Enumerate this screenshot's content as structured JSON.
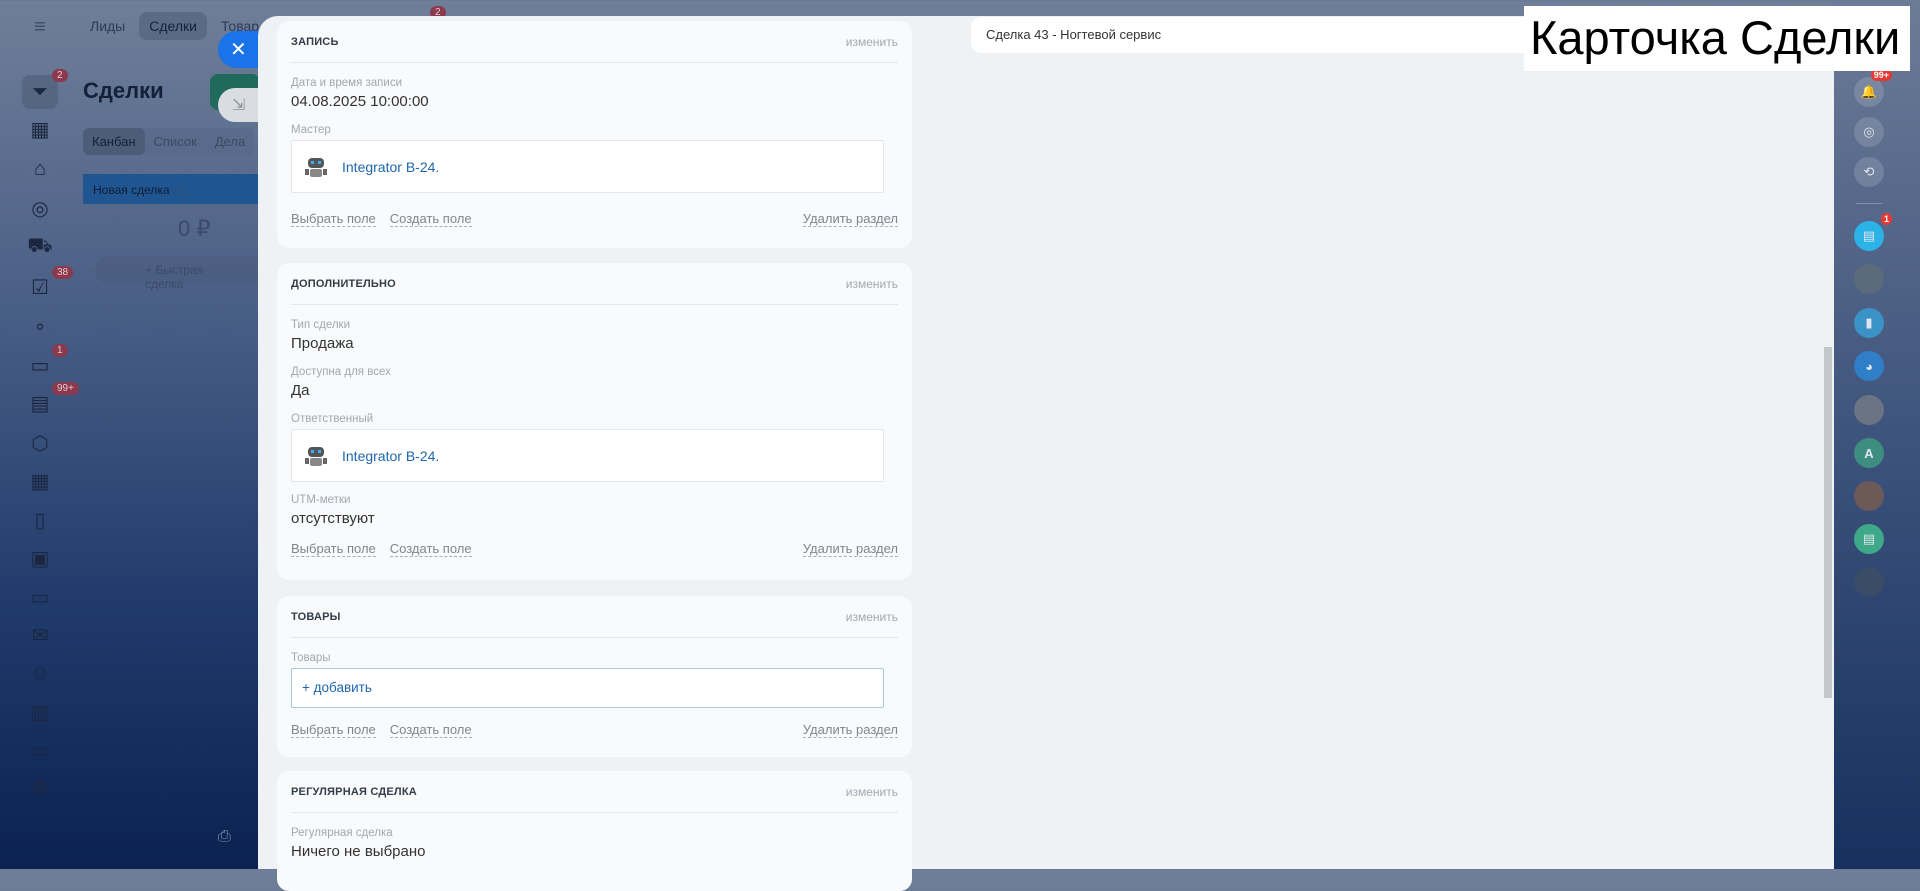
{
  "background": {
    "top_tabs": [
      "Лиды",
      "Сделки",
      "Товар"
    ],
    "top_badge": "2",
    "page_title": "Сделки",
    "views": [
      "Канбан",
      "Список",
      "Дела"
    ],
    "column_name": "Новая сделка",
    "column_count": "(0)",
    "column_sum": "0 ₽",
    "quick_deal": "+ Быстрая сделка",
    "left_badges": {
      "crm": "2",
      "tasks": "38",
      "chat": "1",
      "feed": "99+"
    }
  },
  "slider": {
    "deal_title": "Сделка 43 - Ногтевой сервис",
    "overlay_label": "Карточка Сделки",
    "sections": [
      {
        "title": "Запись",
        "edit": "изменить",
        "fields": [
          {
            "label": "Дата и время записи",
            "value": "04.08.2025 10:00:00"
          },
          {
            "label": "Мастер",
            "user": "Integrator B-24."
          }
        ],
        "select_field": "Выбрать поле",
        "create_field": "Создать поле",
        "delete_section": "Удалить раздел"
      },
      {
        "title": "Дополнительно",
        "edit": "изменить",
        "fields": [
          {
            "label": "Тип сделки",
            "value": "Продажа"
          },
          {
            "label": "Доступна для всех",
            "value": "Да"
          },
          {
            "label": "Ответственный",
            "user": "Integrator B-24."
          },
          {
            "label": "UTM-метки",
            "value": "отсутствуют"
          }
        ],
        "select_field": "Выбрать поле",
        "create_field": "Создать поле",
        "delete_section": "Удалить раздел"
      },
      {
        "title": "Товары",
        "edit": "изменить",
        "fields": [
          {
            "label": "Товары",
            "add": "+ добавить"
          }
        ],
        "select_field": "Выбрать поле",
        "create_field": "Создать поле",
        "delete_section": "Удалить раздел"
      },
      {
        "title": "Регулярная сделка",
        "edit": "изменить",
        "fields": [
          {
            "label": "Регулярная сделка",
            "value": "Ничего не выбрано"
          }
        ]
      }
    ]
  },
  "rightbar": {
    "notifications_badge": "99+",
    "chat_badge": "1",
    "avatar_letter": "A"
  }
}
